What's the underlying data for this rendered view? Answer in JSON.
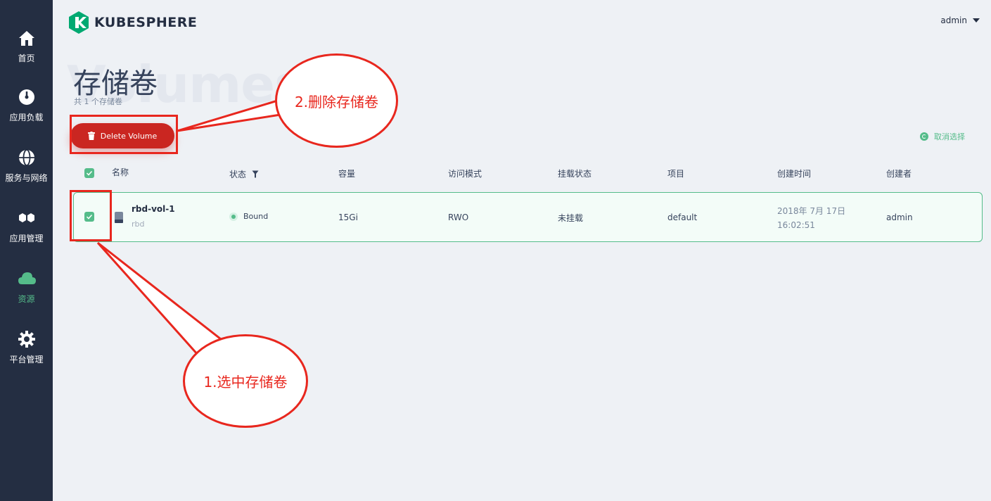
{
  "app": {
    "logo_text": "KUBESPHERE",
    "user": "admin"
  },
  "sidebar": {
    "items": [
      {
        "label": "首页",
        "icon": "home-icon"
      },
      {
        "label": "应用负载",
        "icon": "dashboard-icon"
      },
      {
        "label": "服务与网络",
        "icon": "globe-icon"
      },
      {
        "label": "应用管理",
        "icon": "hexagons-icon"
      },
      {
        "label": "资源",
        "icon": "cloud-icon",
        "active": true
      },
      {
        "label": "平台管理",
        "icon": "gear-icon"
      }
    ]
  },
  "page": {
    "background_word": "Volumes",
    "title": "存储卷",
    "subtitle": "共 1 个存储卷"
  },
  "toolbar": {
    "delete_label": "Delete Volume",
    "cancel_select_label": "取消选择"
  },
  "table": {
    "headers": {
      "name": "名称",
      "status": "状态",
      "capacity": "容量",
      "access_mode": "访问模式",
      "mount_status": "挂载状态",
      "project": "项目",
      "created_time": "创建时间",
      "creator": "创建者"
    },
    "rows": [
      {
        "name": "rbd-vol-1",
        "storage_class": "rbd",
        "status": "Bound",
        "capacity": "15Gi",
        "access_mode": "RWO",
        "mount_status": "未挂载",
        "project": "default",
        "created_date": "2018年 7月 17日",
        "created_time": "16:02:51",
        "creator": "admin",
        "selected": true
      }
    ]
  },
  "annotations": {
    "step1": "1.选中存储卷",
    "step2": "2.删除存储卷"
  },
  "colors": {
    "sidebar_bg": "#242e42",
    "accent_green": "#55bc8a",
    "danger_red": "#ca2621",
    "annotation_red": "#e8271e",
    "page_bg": "#eef1f5"
  }
}
